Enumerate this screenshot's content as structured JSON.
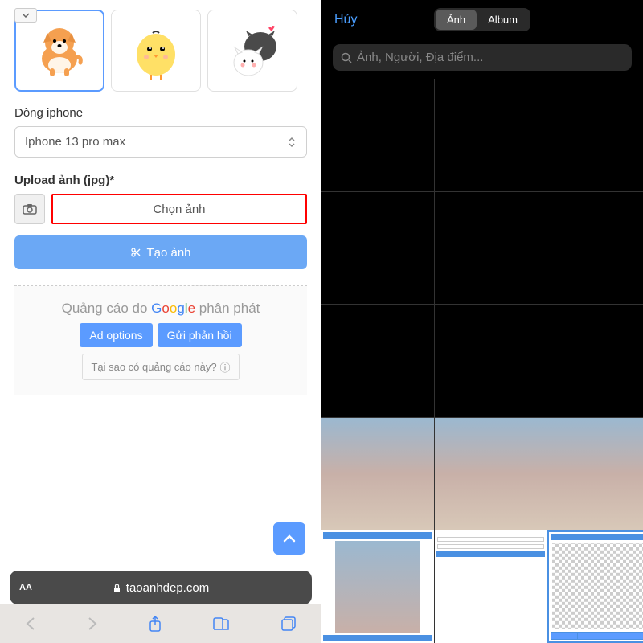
{
  "left": {
    "stickers": [
      "dog-sticker",
      "chick-sticker",
      "cat-heart-sticker"
    ],
    "phone_label": "Dòng iphone",
    "phone_value": "Iphone 13 pro max",
    "upload_label": "Upload ảnh (jpg)*",
    "choose_label": "Chọn ảnh",
    "create_label": "Tạo ảnh",
    "ad_prefix": "Quảng cáo do",
    "ad_google": "Google",
    "ad_suffix": "phân phát",
    "ad_options": "Ad options",
    "ad_feedback": "Gửi phản hồi",
    "ad_why": "Tại sao có quảng cáo này?",
    "font_size": "AA",
    "domain": "taoanhdep.com"
  },
  "right": {
    "cancel": "Hủy",
    "tab_photos": "Ảnh",
    "tab_albums": "Album",
    "search_placeholder": "Ảnh, Người, Địa điểm..."
  }
}
